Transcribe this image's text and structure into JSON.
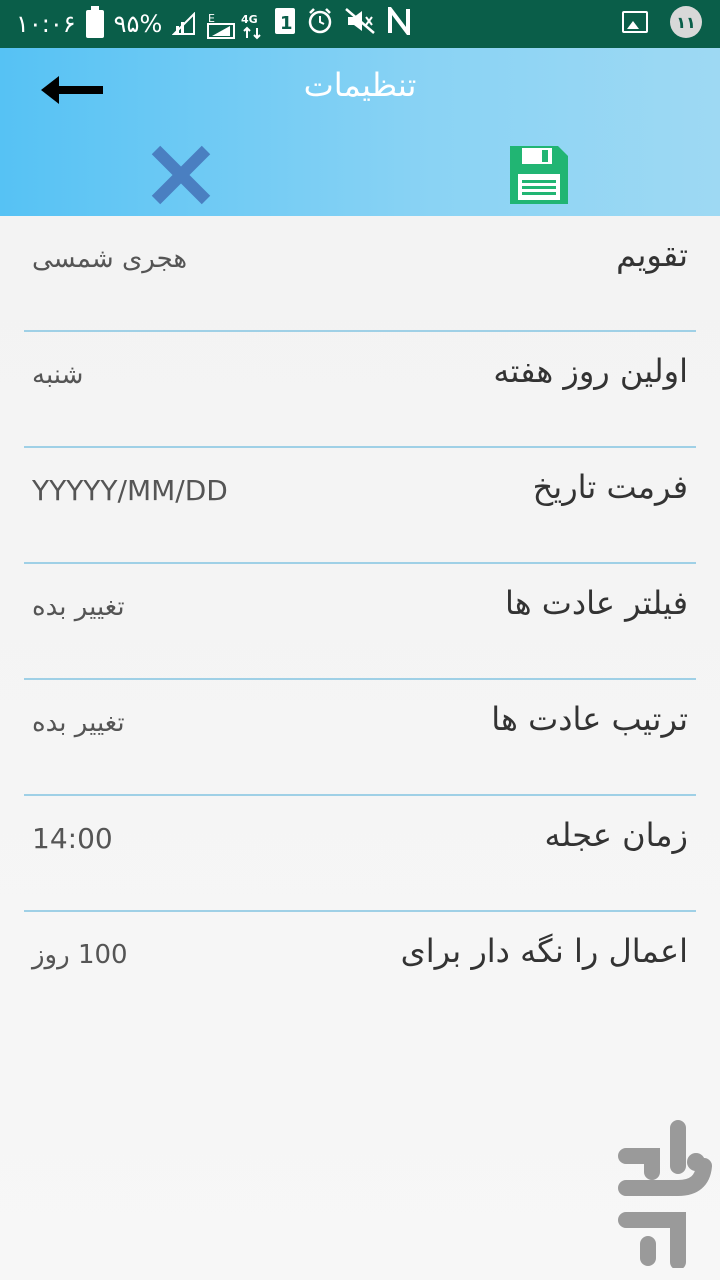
{
  "status_bar": {
    "time": "۱۰:۰۶",
    "battery": "۹۵%",
    "network": "4G",
    "notification_count": "۱۱",
    "icons": [
      "battery-icon",
      "signal-icon",
      "signal-e-icon",
      "signal-4g-icon",
      "sim-1-icon",
      "alarm-icon",
      "mute-icon",
      "nfc-icon",
      "image-notification-icon"
    ]
  },
  "header": {
    "title": "تنظیمات",
    "back_icon": "arrow-left-icon",
    "cancel_icon": "close-icon",
    "save_icon": "floppy-disk-icon",
    "accent_color": "#56c2f4",
    "save_color": "#21b573",
    "cancel_color": "#4a7fc1"
  },
  "settings": [
    {
      "label": "تقویم",
      "value": "هجری شمسی"
    },
    {
      "label": "اولین روز هفته",
      "value": "شنبه"
    },
    {
      "label": "فرمت تاریخ",
      "value": "YYYYY/MM/DD"
    },
    {
      "label": "فیلتر عادت ها",
      "value": "تغییر بده"
    },
    {
      "label": "ترتیب عادت ها",
      "value": "تغییر بده"
    },
    {
      "label": "زمان عجله",
      "value": "14:00"
    },
    {
      "label": "اعمال را نگه دار برای",
      "value": "100 روز"
    }
  ],
  "watermark": {
    "icon": "bazaar-logo-icon"
  }
}
